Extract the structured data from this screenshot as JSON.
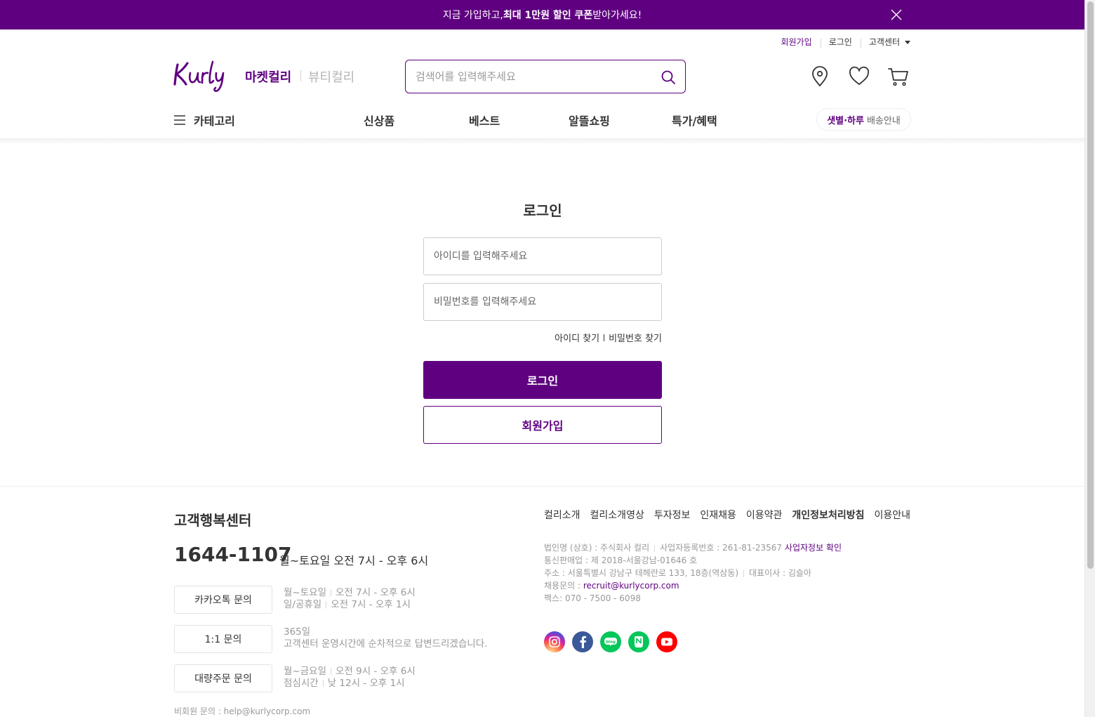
{
  "banner": {
    "text_pre": "지금 가입하고, ",
    "text_bold": "최대 1만원 할인 쿠폰",
    "text_post": " 받아가세요!"
  },
  "user_menu": {
    "signup": "회원가입",
    "login": "로그인",
    "customer_center": "고객센터"
  },
  "header": {
    "brand_market": "마켓컬리",
    "brand_beauty": "뷰티컬리",
    "search_placeholder": "검색어를 입력해주세요"
  },
  "gnb": {
    "category": "카테고리",
    "items": [
      "신상품",
      "베스트",
      "알뜰쇼핑",
      "특가/혜택"
    ],
    "delivery_bold": "샛별·하루",
    "delivery_text": "배송안내"
  },
  "login": {
    "title": "로그인",
    "id_placeholder": "아이디를 입력해주세요",
    "pw_placeholder": "비밀번호를 입력해주세요",
    "find_id": "아이디 찾기",
    "find_pw": "비밀번호 찾기",
    "login_button": "로그인",
    "signup_button": "회원가입"
  },
  "footer": {
    "cs_title": "고객행복센터",
    "phone": "1644-1107",
    "phone_hours": "월~토요일 오전 7시 - 오후 6시",
    "channels": [
      {
        "label": "카카오톡 문의",
        "line1_a": "월~토요일",
        "line1_b": "오전 7시 - 오후 6시",
        "line2_a": "일/공휴일",
        "line2_b": "오전 7시 - 오후 1시"
      },
      {
        "label": "1:1 문의",
        "line1": "365일",
        "line2": "고객센터 운영시간에 순차적으로 답변드리겠습니다."
      },
      {
        "label": "대량주문 문의",
        "line1_a": "월~금요일",
        "line1_b": "오전 9시 - 오후 6시",
        "line2_a": "점심시간",
        "line2_b": "낮 12시 - 오후 1시"
      }
    ],
    "non_member": "비회원 문의 : help@kurlycorp.com",
    "links": [
      "컬리소개",
      "컬리소개영상",
      "투자정보",
      "인재채용",
      "이용약관",
      "개인정보처리방침",
      "이용안내"
    ],
    "company": {
      "name": "법인명 (상호) : 주식회사 컬리",
      "biz_no": "사업자등록번호 : 261-81-23567",
      "biz_check": "사업자정보 확인",
      "mail_order": "통신판매업 : 제 2018-서울강남-01646 호",
      "address": "주소 : 서울특별시 강남구 테헤란로 133, 18층(역삼동)",
      "ceo": "대표이사 : 김슬아",
      "recruit_label": "채용문의 : ",
      "recruit_email": "recruit@kurlycorp.com",
      "fax": "팩스: 070 - 7500 - 6098"
    },
    "sns": [
      "instagram-icon",
      "facebook-icon",
      "naver-blog-icon",
      "naver-post-icon",
      "youtube-icon"
    ]
  },
  "colors": {
    "brand": "#5f0080",
    "instagram": "#d6249f",
    "facebook": "#3b5998",
    "naver": "#03c75a",
    "youtube": "#ff0000"
  }
}
